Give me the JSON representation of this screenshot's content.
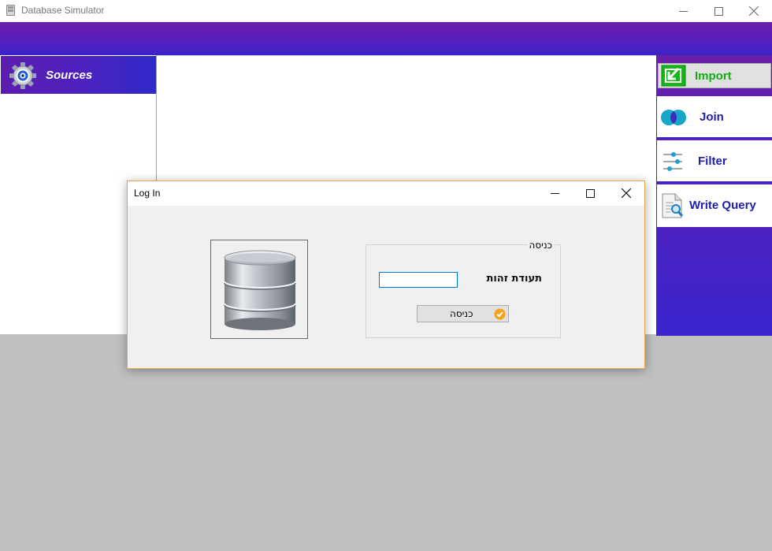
{
  "window": {
    "title": "Database Simulator"
  },
  "sidebar": {
    "header_label": "Sources",
    "header_icon": "gear-icon"
  },
  "actions": {
    "import_label": "Import",
    "join_label": "Join",
    "filter_label": "Filter",
    "write_query_label": "Write Query"
  },
  "dialog": {
    "title": "Log In",
    "group_title": "כניסה",
    "id_label": "תעודת זהות",
    "id_value": "",
    "login_button_label": "כניסה"
  },
  "colors": {
    "band_purple": "#6a1fa8",
    "band_blue": "#3b23c9",
    "import_green": "#11b011",
    "action_blue": "#1e1eb0",
    "dialog_border": "#e6a44e"
  }
}
